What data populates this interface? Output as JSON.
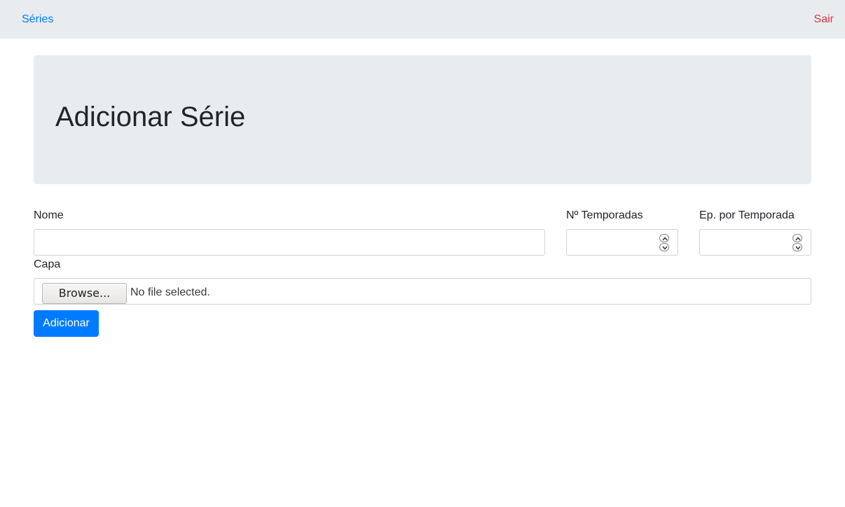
{
  "nav": {
    "brand": "Séries",
    "logout": "Sair",
    "brand_color": "#007bff",
    "logout_color": "#dc3545"
  },
  "header": {
    "title": "Adicionar Série"
  },
  "form": {
    "nome_label": "Nome",
    "nome_value": "",
    "temporadas_label": "Nº Temporadas",
    "temporadas_value": "",
    "episodios_label": "Ep. por Temporada",
    "episodios_value": "",
    "capa_label": "Capa",
    "browse_label": "Browse...",
    "file_status": "No file selected.",
    "submit_label": "Adicionar",
    "submit_color": "#007bff"
  }
}
